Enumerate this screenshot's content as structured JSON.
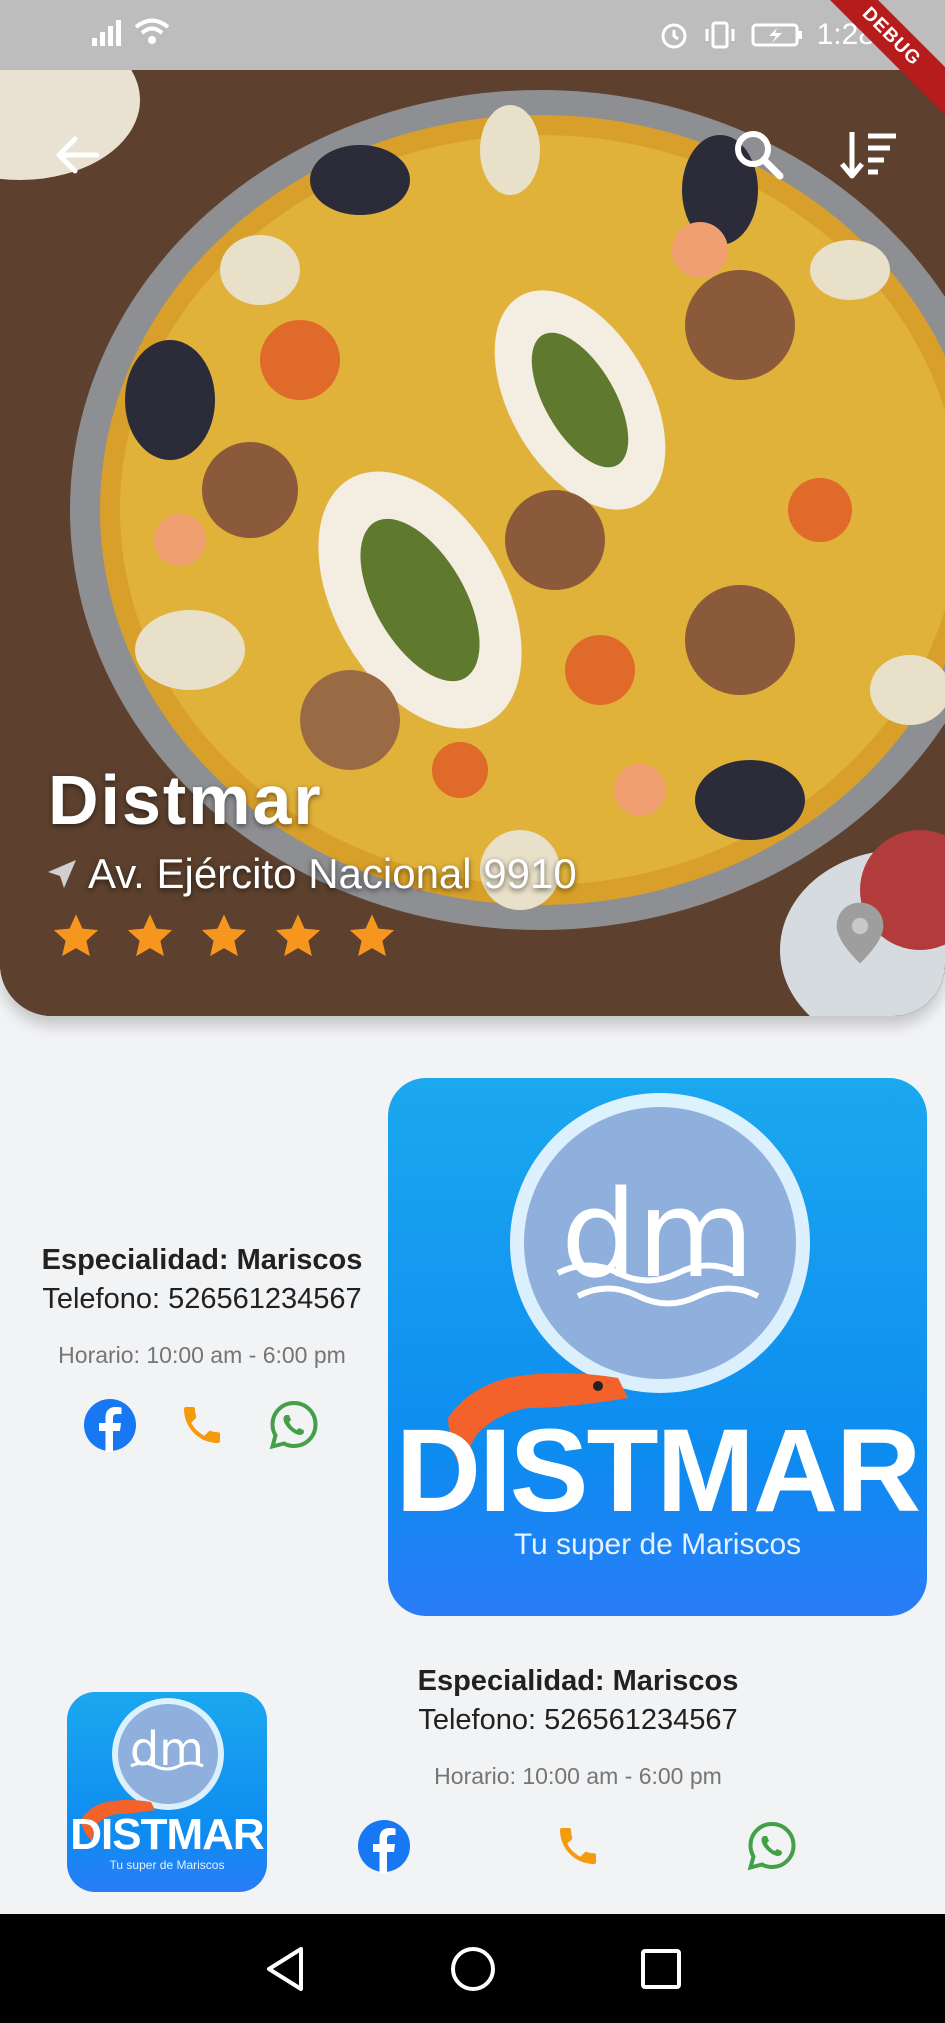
{
  "status_bar": {
    "time": "1:28",
    "debug_label": "DEBUG"
  },
  "restaurant": {
    "name": "Distmar",
    "address": "Av. Ejército Nacional 9910",
    "rating": 5,
    "rating_max": 5
  },
  "cards": [
    {
      "specialty": "Especialidad: Mariscos",
      "phone": "Telefono: 526561234567",
      "hours": "Horario: 10:00 am - 6:00 pm",
      "logo": {
        "title": "DISTMAR",
        "subtitle": "Tu super de Mariscos",
        "monogram": "dm"
      }
    },
    {
      "specialty": "Especialidad: Mariscos",
      "phone": "Telefono: 526561234567",
      "hours": "Horario: 10:00 am - 6:00 pm",
      "logo": {
        "title": "DISTMAR",
        "subtitle": "Tu super de Mariscos",
        "monogram": "dm"
      }
    }
  ],
  "icons": {
    "back": "arrow-back-icon",
    "search": "search-icon",
    "sort": "sort-icon",
    "facebook": "facebook-icon",
    "phone": "phone-icon",
    "whatsapp": "whatsapp-icon",
    "location": "location-pin-icon"
  },
  "colors": {
    "star": "#f7961e",
    "facebook": "#1877f2",
    "phone": "#f59a0c",
    "whatsapp": "#43a047",
    "logo_blue": "#0d8cf0"
  }
}
